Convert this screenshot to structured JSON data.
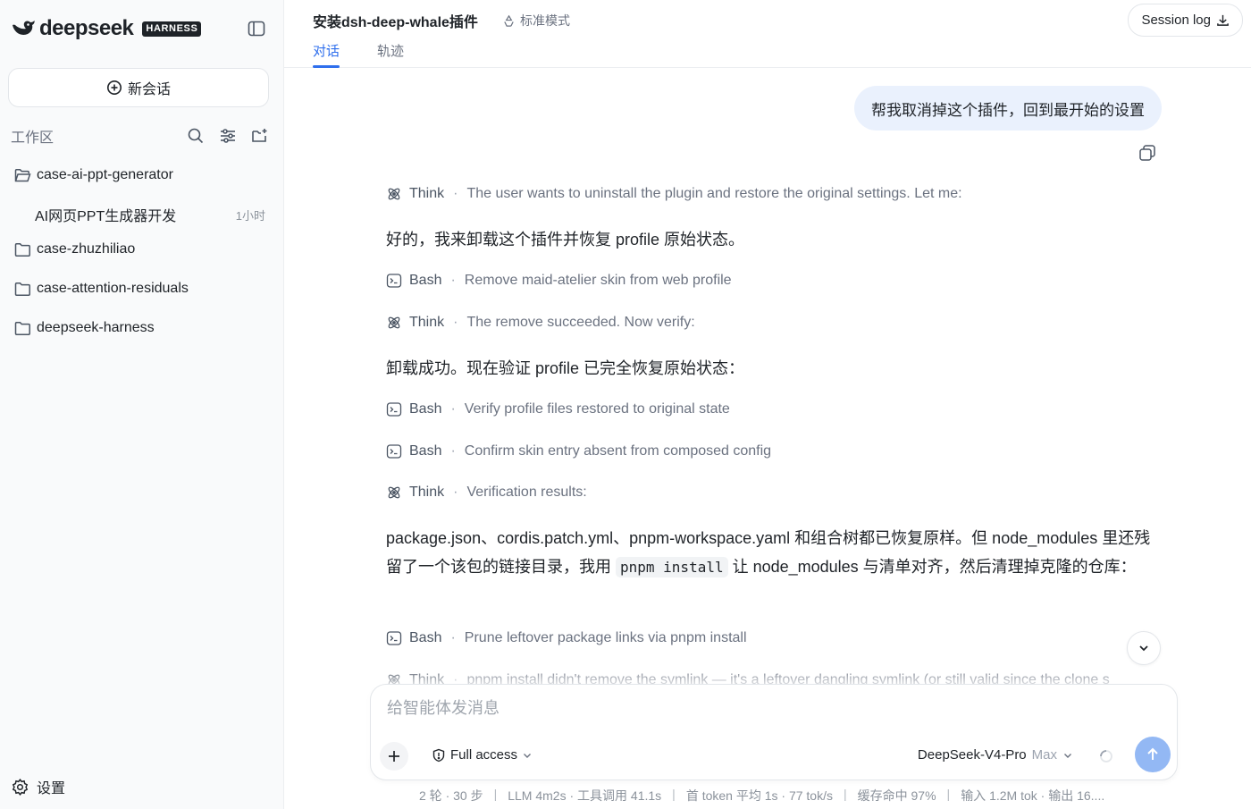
{
  "brand": {
    "name": "deepseek",
    "badge": "HARNESS"
  },
  "sidebar": {
    "new_chat": "新会话",
    "workspace_label": "工作区",
    "folders": [
      {
        "name": "case-ai-ppt-generator"
      },
      {
        "name": "case-zhuzhiliao"
      },
      {
        "name": "case-attention-residuals"
      },
      {
        "name": "deepseek-harness"
      }
    ],
    "session": {
      "title": "AI网页PPT生成器开发",
      "time": "1小时"
    },
    "settings": "设置"
  },
  "header": {
    "title": "安装dsh-deep-whale插件",
    "mode": "标准模式",
    "tabs": [
      "对话",
      "轨迹"
    ],
    "session_log": "Session log"
  },
  "conversation": {
    "user_message": "帮我取消掉这个插件，回到最开始的设置",
    "steps": [
      {
        "kind": "Think",
        "text": "The user wants to uninstall the plugin and restore the original settings. Let me:"
      },
      {
        "kind": "Bash",
        "text": "Remove maid-atelier skin from web profile"
      },
      {
        "kind": "Think",
        "text": "The remove succeeded. Now verify:"
      },
      {
        "kind": "Bash",
        "text": "Verify profile files restored to original state"
      },
      {
        "kind": "Bash",
        "text": "Confirm skin entry absent from composed config"
      },
      {
        "kind": "Think",
        "text": "Verification results:"
      },
      {
        "kind": "Bash",
        "text": "Prune leftover package links via pnpm install"
      },
      {
        "kind": "Think",
        "text": "pnpm install didn't remove the symlink — it's a leftover dangling symlink (or still valid since the clone s"
      }
    ],
    "assistant_1": "好的，我来卸载这个插件并恢复 profile 原始状态。",
    "assistant_2": "卸载成功。现在验证 profile 已完全恢复原始状态：",
    "assistant_3_a": "package.json、cordis.patch.yml、pnpm-workspace.yaml 和组合树都已恢复原样。但 node_modules 里还残留了一个该包的链接目录，我用 ",
    "assistant_3_code": "pnpm install",
    "assistant_3_b": " 让 node_modules 与清单对齐，然后清理掉克隆的仓库："
  },
  "composer": {
    "placeholder": "给智能体发消息",
    "access": "Full access",
    "model": "DeepSeek-V4-Pro",
    "effort": "Max"
  },
  "stats": {
    "turns": "2 轮 · 30 步",
    "llm": "LLM 4m2s · 工具调用 41.1s",
    "first_token": "首 token 平均 1s · 77 tok/s",
    "cache": "缓存命中 97%",
    "io": "输入 1.2M tok · 输出 16...."
  },
  "colors": {
    "accent": "#2f6fed",
    "bubble": "#eaf1fd",
    "send": "#93b8f4"
  }
}
